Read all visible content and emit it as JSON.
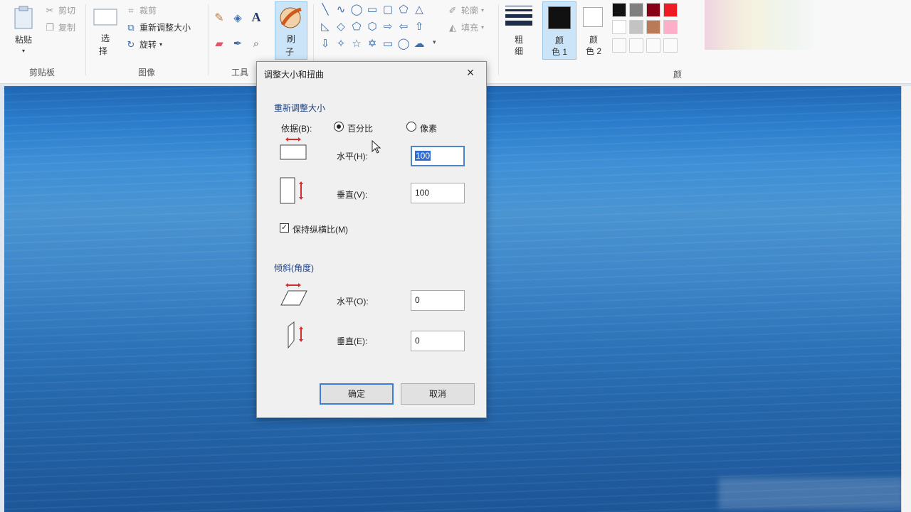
{
  "ribbon": {
    "clipboard": {
      "paste": "粘贴",
      "cut": "剪切",
      "copy": "复制",
      "group": "剪贴板"
    },
    "image": {
      "select_line1": "选",
      "select_line2": "择",
      "crop": "裁剪",
      "resize": "重新调整大小",
      "rotate": "旋转",
      "group": "图像"
    },
    "tools": {
      "group": "工具",
      "text_icon": "A"
    },
    "brushes": {
      "line1": "刷",
      "line2": "子"
    },
    "shapes": {
      "outline": "轮廓",
      "fill": "填充"
    },
    "size": {
      "line1": "粗",
      "line2": "细"
    },
    "color1": {
      "line1": "颜",
      "line2": "色 1"
    },
    "color2": {
      "line1": "颜",
      "line2": "色 2"
    },
    "colors_group_partial": "颜",
    "palette": [
      "#111111",
      "#7f7f7f",
      "#880015",
      "#ed1c24",
      "#ffffff",
      "#c3c3c3",
      "#b97a57",
      "#ffaec9"
    ]
  },
  "dialog": {
    "title": "调整大小和扭曲",
    "close": "×",
    "resize_section": "重新调整大小",
    "by_label": "依据(B):",
    "percent": "百分比",
    "pixels": "像素",
    "horizontal_label": "水平(H):",
    "horizontal_value": "100",
    "vertical_label": "垂直(V):",
    "vertical_value": "100",
    "keep_ratio": "保持纵横比(M)",
    "skew_section": "倾斜(角度)",
    "skew_h_label": "水平(O):",
    "skew_h_value": "0",
    "skew_v_label": "垂直(E):",
    "skew_v_value": "0",
    "ok": "确定",
    "cancel": "取消"
  }
}
